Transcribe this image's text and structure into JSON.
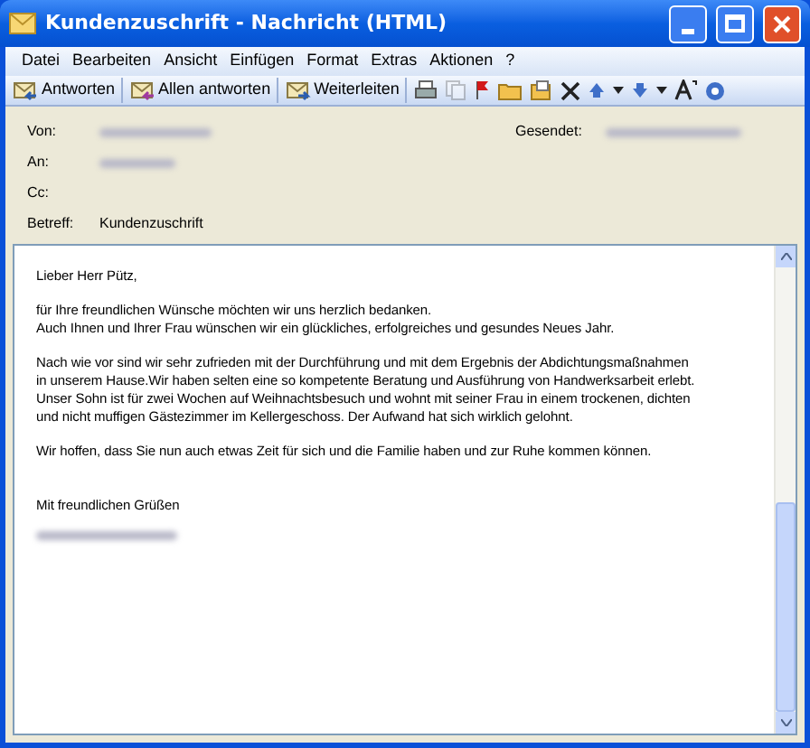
{
  "window": {
    "title": "Kundenzuschrift - Nachricht (HTML)"
  },
  "menu": [
    "Datei",
    "Bearbeiten",
    "Ansicht",
    "Einfügen",
    "Format",
    "Extras",
    "Aktionen",
    "?"
  ],
  "toolbar": {
    "buttons": [
      "Antworten",
      "Allen antworten",
      "Weiterleiten"
    ],
    "icon_buttons": [
      {
        "disabled": false
      },
      {
        "disabled": true
      },
      {
        "disabled": false
      },
      {
        "disabled": false
      },
      {
        "disabled": false
      },
      {
        "disabled": false
      },
      {
        "disabled": false
      },
      {
        "disabled": false
      },
      {
        "disabled": false
      },
      {
        "disabled": false
      },
      {
        "disabled": false
      },
      {
        "disabled": false
      }
    ]
  },
  "header": {
    "from_label": "Von:",
    "to_label": "An:",
    "cc_label": "Cc:",
    "subject_label": "Betreff:",
    "subject": "Kundenzuschrift",
    "sent_label": "Gesendet:"
  },
  "body": {
    "paragraphs": [
      {
        "kind": "text",
        "lines": [
          "Lieber Herr Pütz,"
        ]
      },
      {
        "kind": "text",
        "lines": [
          "für Ihre freundlichen Wünsche möchten wir uns herzlich bedanken.",
          "Auch Ihnen und Ihrer Frau wünschen wir ein glückliches, erfolgreiches und gesundes Neues Jahr."
        ]
      },
      {
        "kind": "text",
        "lines": [
          "Nach wie vor sind wir sehr zufrieden mit der Durchführung und mit dem Ergebnis der Abdichtungsmaßnahmen",
          "in unserem Hause.Wir haben selten eine so kompetente Beratung und Ausführung von Handwerksarbeit erlebt.",
          "Unser Sohn ist für zwei Wochen auf Weihnachtsbesuch und wohnt mit seiner Frau in einem trockenen, dichten",
          "und nicht muffigen Gästezimmer im Kellergeschoss. Der Aufwand hat sich wirklich gelohnt."
        ]
      },
      {
        "kind": "text",
        "lines": [
          "Wir hoffen, dass Sie nun auch etwas Zeit für sich und die Familie haben und zur Ruhe kommen können."
        ]
      },
      {
        "kind": "spacer"
      },
      {
        "kind": "text",
        "lines": [
          "Mit freundlichen Grüßen"
        ]
      },
      {
        "kind": "blurred"
      }
    ]
  }
}
